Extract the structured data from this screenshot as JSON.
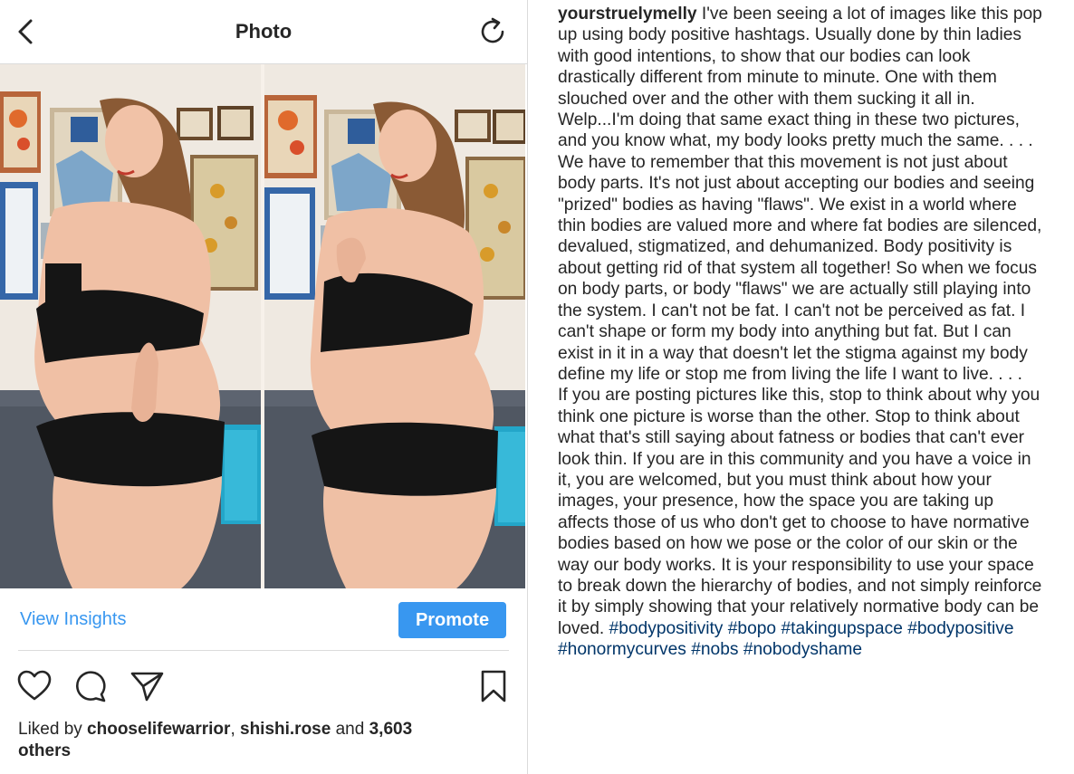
{
  "header": {
    "title": "Photo"
  },
  "post": {
    "image_alt": "Two side-by-side photos of a smiling woman in a black bra and black underwear standing sideways in front of a wall of framed art and a gray couch",
    "insights_label": "View Insights",
    "promote_label": "Promote",
    "likes": {
      "prefix": "Liked by ",
      "user1": "chooselifewarrior",
      "sep": ", ",
      "user2": "shishi.rose",
      "middle": " and ",
      "count": "3,603",
      "suffix": "others"
    }
  },
  "caption": {
    "username": "yourstruelymelly",
    "paragraph1": "I've been seeing a lot of images like this pop up using body positive hashtags. Usually done by thin ladies with good intentions, to show that our bodies can look drastically different from minute to minute. One with them slouched over and the other with them sucking it all in. Welp...I'm doing that same exact thing in these two pictures, and you know what, my body looks pretty much the same. . . .",
    "paragraph2": "We have to remember that this movement is not just about body parts. It's not just about accepting our bodies and seeing \"prized\" bodies as having \"flaws\". We exist in a world where thin bodies are valued more and where fat bodies are silenced, devalued, stigmatized, and dehumanized. Body positivity is about getting rid of that system all together! So when we focus on body parts, or body \"flaws\" we are actually still playing into the system. I can't not be fat. I can't not be perceived as fat. I can't shape or form my body into anything but fat. But I can exist in it in a way that doesn't let the stigma against my body define my life or stop me from living the life I want to live. . . .",
    "paragraph3": "If you are posting pictures like this, stop to think about why you think one picture is worse than the other. Stop to think about what that's still saying about fatness or bodies that can't ever look thin. If you are in this community and you have a voice in it, you are welcomed, but you must think about how your images, your presence, how the space you are taking up affects those of us who don't get to choose to have normative bodies based on how we pose or the color of our skin or the way our body works.  It is your responsibility to use your space to break down the hierarchy of bodies, and not simply reinforce it by simply showing that your relatively normative body can be loved.",
    "hashtags": [
      "#bodypositivity",
      "#bopo",
      "#takingupspace",
      "#bodypositive",
      "#honormycurves",
      "#nobs",
      "#nobodyshame"
    ]
  },
  "colors": {
    "accent": "#3897f0",
    "hashtag": "#003569",
    "text": "#262626",
    "divider": "#dbdbdb"
  },
  "icons": [
    "back-arrow-icon",
    "refresh-icon",
    "heart-icon",
    "comment-icon",
    "share-icon",
    "bookmark-icon"
  ]
}
